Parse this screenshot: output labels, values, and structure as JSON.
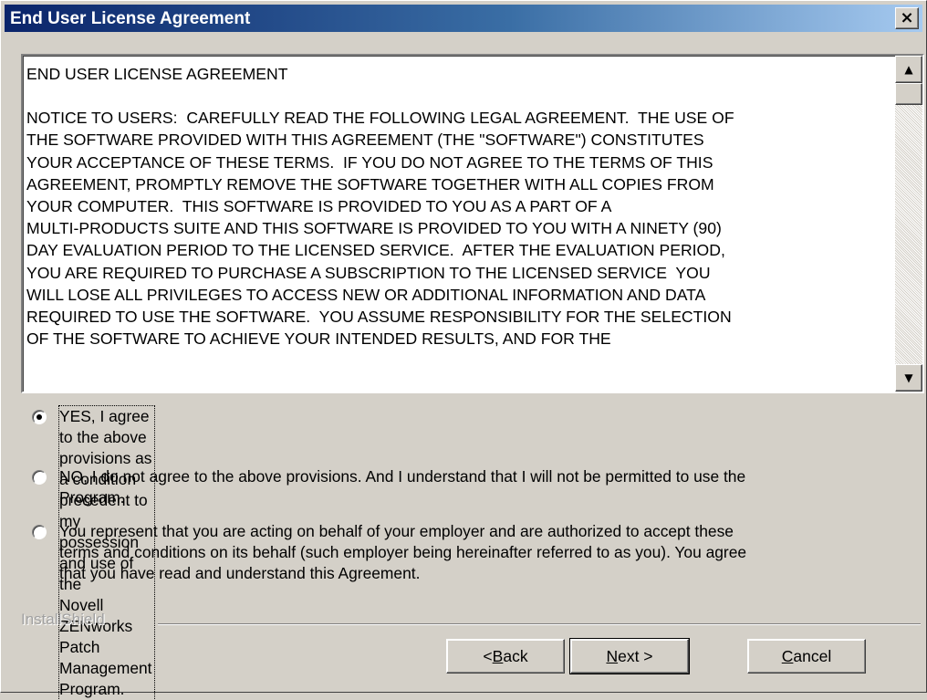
{
  "window": {
    "title": "End User License Agreement",
    "close_glyph": "×"
  },
  "license": {
    "heading": "END USER LICENSE AGREEMENT",
    "body": "NOTICE TO USERS:  CAREFULLY READ THE FOLLOWING LEGAL AGREEMENT.  THE USE OF\nTHE SOFTWARE PROVIDED WITH THIS AGREEMENT (THE \"SOFTWARE\") CONSTITUTES\nYOUR ACCEPTANCE OF THESE TERMS.  IF YOU DO NOT AGREE TO THE TERMS OF THIS\nAGREEMENT, PROMPTLY REMOVE THE SOFTWARE TOGETHER WITH ALL COPIES FROM\nYOUR COMPUTER.  THIS SOFTWARE IS PROVIDED TO YOU AS A PART OF A\nMULTI-PRODUCTS SUITE AND THIS SOFTWARE IS PROVIDED TO YOU WITH A NINETY (90)\nDAY EVALUATION PERIOD TO THE LICENSED SERVICE.  AFTER THE EVALUATION PERIOD,\nYOU ARE REQUIRED TO PURCHASE A SUBSCRIPTION TO THE LICENSED SERVICE  YOU\nWILL LOSE ALL PRIVILEGES TO ACCESS NEW OR ADDITIONAL INFORMATION AND DATA\nREQUIRED TO USE THE SOFTWARE.  YOU ASSUME RESPONSIBILITY FOR THE SELECTION\nOF THE SOFTWARE TO ACHIEVE YOUR INTENDED RESULTS, AND FOR THE"
  },
  "options": [
    {
      "line1": "YES, I agree to the above provisions as a condition precedent to my possession and use of the",
      "line2": "Novell ZENworks Patch Management Program.",
      "checked": true
    },
    {
      "line1": "NO, I do not agree to the above provisions. And I understand that I will not be permitted to use the",
      "line2": "Program.",
      "checked": false
    },
    {
      "line1": "You represent that you are acting on behalf of your employer and are authorized to accept these",
      "line2": "terms and conditions on its behalf (such employer being hereinafter referred to as you). You agree",
      "line3": "that you have read and understand this Agreement.",
      "checked": false
    }
  ],
  "footer": {
    "brand": "InstallShield"
  },
  "buttons": {
    "back_prefix": "< ",
    "back_key": "B",
    "back_rest": "ack",
    "next_key": "N",
    "next_rest": "ext >",
    "cancel_key": "C",
    "cancel_rest": "ancel"
  },
  "icons": {
    "scroll_up": "▲",
    "scroll_down": "▼"
  }
}
